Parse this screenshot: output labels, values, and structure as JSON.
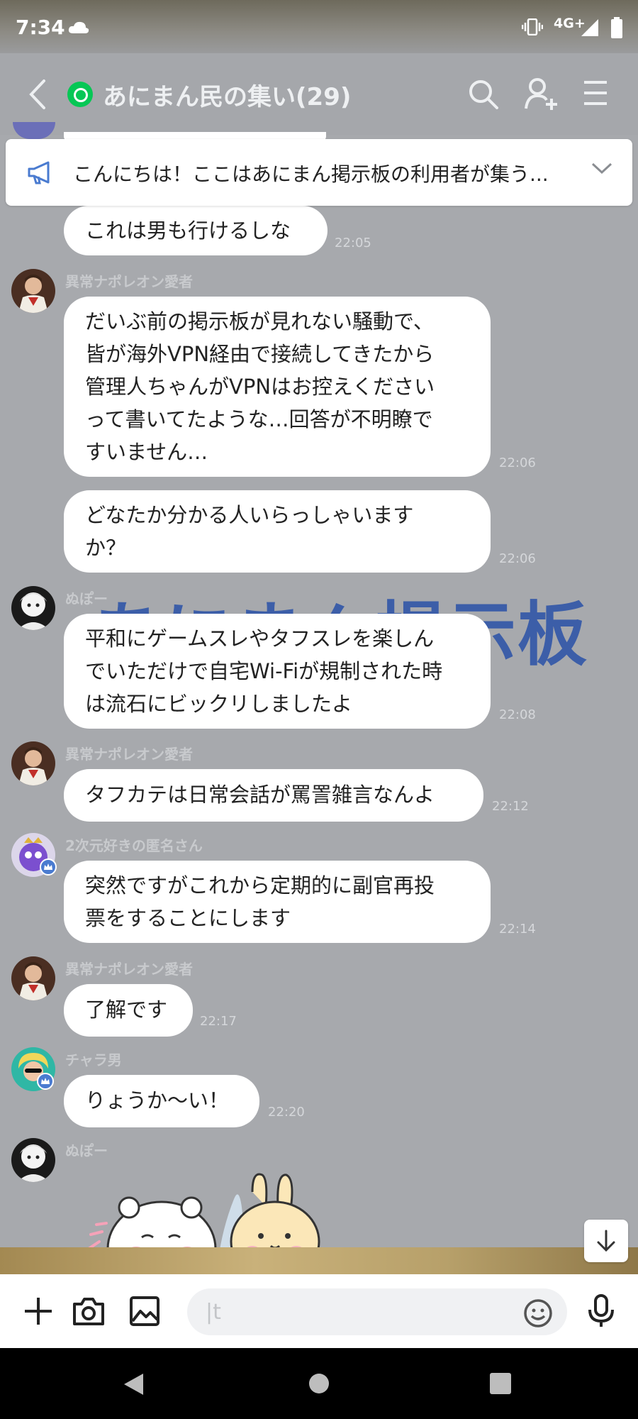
{
  "status_bar": {
    "time": "7:34",
    "network": "4G+"
  },
  "header": {
    "title": "あにまん民の集い(29)"
  },
  "announcement": {
    "text": "こんにちは！ここはあにまん掲示板の利用者が集う..."
  },
  "watermark": {
    "text": "あにまん掲示板"
  },
  "messages": [
    {
      "sender": "",
      "lines": [
        "これは男も行けるしな"
      ],
      "time": "22:05"
    },
    {
      "sender": "異常ナポレオン愛者",
      "lines": [
        "だいぶ前の掲示板が見れない騒動で、",
        "皆が海外VPN経由で接続してきたから",
        "管理人ちゃんがVPNはお控えください",
        "って書いてたような…回答が不明瞭で",
        "すいません…"
      ],
      "time": "22:06"
    },
    {
      "sender": "",
      "lines": [
        "どなたか分かる人いらっしゃいます",
        "か？"
      ],
      "time": "22:06"
    },
    {
      "sender": "ぬぽー",
      "lines": [
        "平和にゲームスレやタフスレを楽しん",
        "でいただけで自宅Wi-Fiが規制された時",
        "は流石にビックリしましたよ"
      ],
      "time": "22:08"
    },
    {
      "sender": "異常ナポレオン愛者",
      "lines": [
        "タフカテは日常会話が罵詈雑言なんよ"
      ],
      "time": "22:12"
    },
    {
      "sender": "2次元好きの匿名さん",
      "lines": [
        "突然ですがこれから定期的に副官再投",
        "票をすることにします"
      ],
      "time": "22:14"
    },
    {
      "sender": "異常ナポレオン愛者",
      "lines": [
        "了解です"
      ],
      "time": "22:17"
    },
    {
      "sender": "チャラ男",
      "lines": [
        "りょうか〜い！"
      ],
      "time": "22:20"
    },
    {
      "sender": "ぬぽー",
      "lines": [],
      "time": ""
    }
  ],
  "input": {
    "placeholder": "|t"
  },
  "colors": {
    "line_green": "#06c755",
    "watermark_blue": "#2a51a8"
  }
}
